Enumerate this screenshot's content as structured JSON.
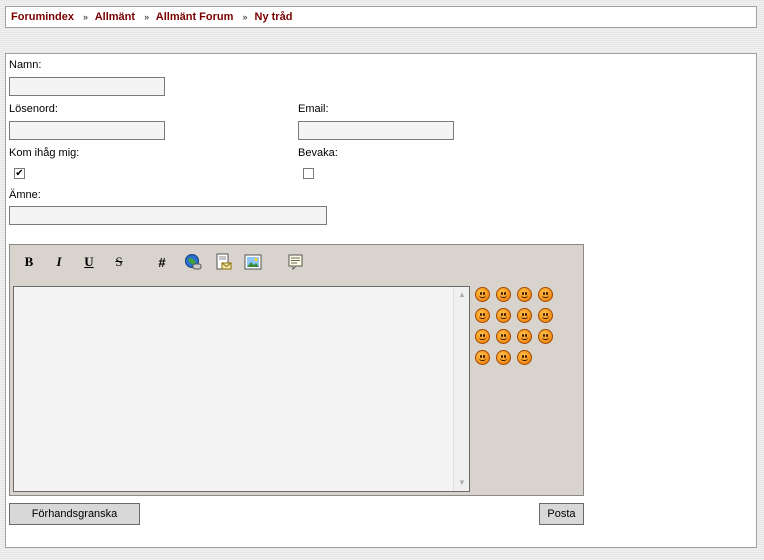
{
  "breadcrumb": {
    "items": [
      "Forumindex",
      "Allmänt",
      "Allmänt Forum",
      "Ny tråd"
    ],
    "separator": "»"
  },
  "form": {
    "name_label": "Namn:",
    "name_value": "",
    "password_label": "Lösenord:",
    "password_value": "",
    "email_label": "Email:",
    "email_value": "",
    "remember_label": "Kom ihåg mig:",
    "remember_checked": true,
    "watch_label": "Bevaka:",
    "watch_checked": false,
    "subject_label": "Ämne:",
    "subject_value": ""
  },
  "toolbar": {
    "bold": "B",
    "italic": "I",
    "underline": "U",
    "strike": "S",
    "hash": "#",
    "icons": [
      "globe-link-icon",
      "email-insert-icon",
      "image-insert-icon",
      "quote-icon"
    ]
  },
  "editor": {
    "message_value": "",
    "smileys": [
      "surprised",
      "grin",
      "frown",
      "smile",
      "shocked",
      "confused",
      "cool",
      "smile",
      "angry",
      "dizzy",
      "happy",
      "wink",
      "sad",
      "unsure",
      "neutral"
    ]
  },
  "buttons": {
    "preview": "Förhandsgranska",
    "post": "Posta"
  },
  "colors": {
    "breadcrumb_link": "#7a0000",
    "editor_bg": "#d8d4cd",
    "smiley": "#f7941d"
  }
}
